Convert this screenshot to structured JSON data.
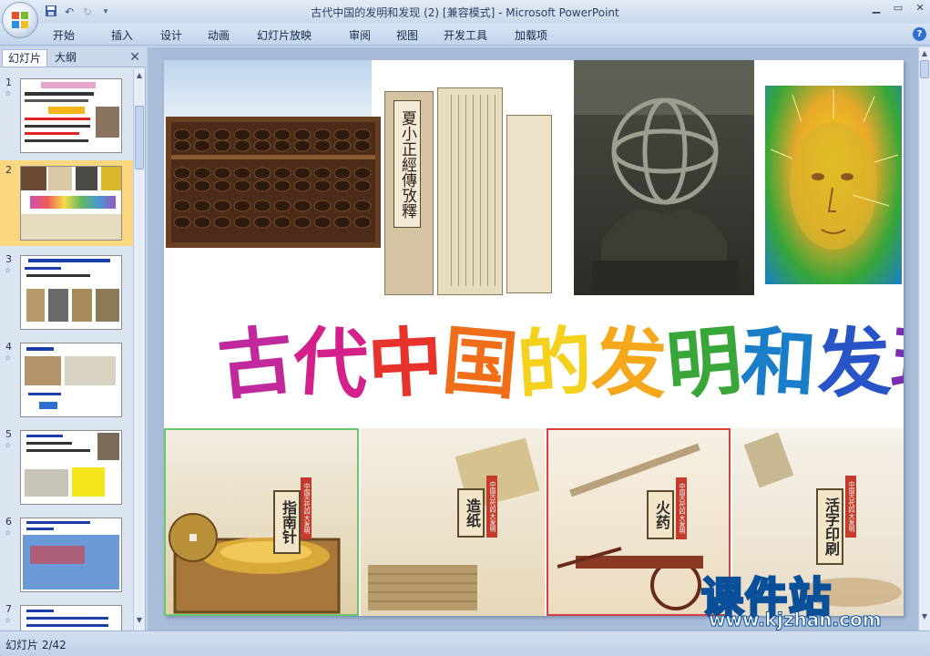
{
  "window": {
    "title": "古代中国的发明和发现 (2) [兼容模式] - Microsoft PowerPoint"
  },
  "ribbon": {
    "tabs": [
      "开始",
      "插入",
      "设计",
      "动画",
      "幻灯片放映",
      "审阅",
      "视图",
      "开发工具",
      "加载项"
    ]
  },
  "left_panel": {
    "tabs": [
      "幻灯片",
      "大纲"
    ],
    "thumbnails": [
      {
        "number": "1",
        "selected": false
      },
      {
        "number": "2",
        "selected": true
      },
      {
        "number": "3",
        "selected": false
      },
      {
        "number": "4",
        "selected": false
      },
      {
        "number": "5",
        "selected": false
      },
      {
        "number": "6",
        "selected": false
      },
      {
        "number": "7",
        "selected": false
      }
    ]
  },
  "slide": {
    "title_chars": [
      {
        "char": "古",
        "color": "#c0289c"
      },
      {
        "char": "代",
        "color": "#d4208a"
      },
      {
        "char": "中",
        "color": "#e8322c"
      },
      {
        "char": "国",
        "color": "#f06d1a"
      },
      {
        "char": "的",
        "color": "#f4d11c"
      },
      {
        "char": "发",
        "color": "#f5a81c"
      },
      {
        "char": "明",
        "color": "#38a638"
      },
      {
        "char": "和",
        "color": "#1a7fc8"
      },
      {
        "char": "发",
        "color": "#2854c8"
      },
      {
        "char": "现",
        "color": "#7a2fb0"
      }
    ],
    "invention_cards": [
      {
        "label": "指南针"
      },
      {
        "label": "造纸"
      },
      {
        "label": "火药"
      },
      {
        "label": "活字印刷"
      }
    ],
    "card_tag": "中国古代四大发明",
    "book_title": "夏小正經傳攷釋"
  },
  "watermark": {
    "main": "课件站",
    "url": "www.kjzhan.com"
  },
  "statusbar": {
    "slide_indicator": "幻灯片 2/42"
  },
  "colors": {
    "ribbon_bg": "#c2d4ec",
    "selected_thumb": "#fbd87f",
    "slide_bg": "#a9bcd8"
  }
}
